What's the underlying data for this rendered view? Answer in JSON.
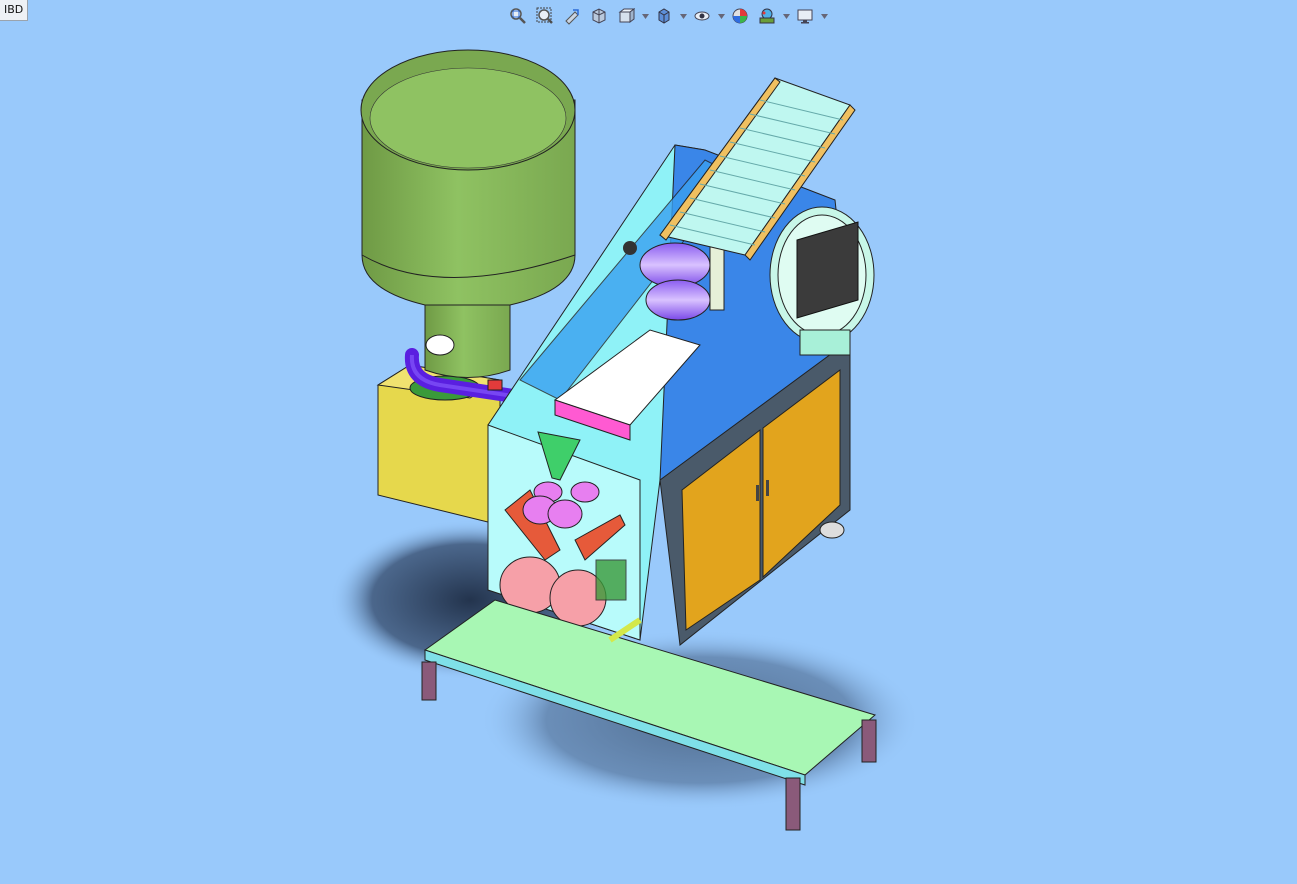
{
  "view": {
    "orientation_label": "IBD"
  },
  "toolbar": {
    "buttons": [
      {
        "name": "zoom-to-fit-icon"
      },
      {
        "name": "zoom-to-area-icon"
      },
      {
        "name": "previous-view-icon"
      },
      {
        "name": "section-view-icon"
      },
      {
        "name": "view-orientation-icon",
        "dropdown": true
      },
      {
        "name": "display-style-icon",
        "dropdown": true
      },
      {
        "name": "hide-show-items-icon",
        "dropdown": true
      },
      {
        "name": "edit-appearance-icon"
      },
      {
        "name": "apply-scene-icon",
        "dropdown": true
      },
      {
        "name": "view-settings-icon",
        "dropdown": true
      }
    ]
  },
  "colors": {
    "background": "#99c9fb",
    "hopper": "#8ab860",
    "frame_cyan": "#8ff2f7",
    "frame_blue": "#3a86e8",
    "cabinet_door": "#e2a41d",
    "yellow_box": "#e6d84c",
    "conveyor_belt": "#a8f7b4",
    "pink_roller": "#f6a0a8",
    "purple_pipe": "#5a1fe0",
    "orange_chain": "#f0c060",
    "screen": "#3b3b3b"
  }
}
